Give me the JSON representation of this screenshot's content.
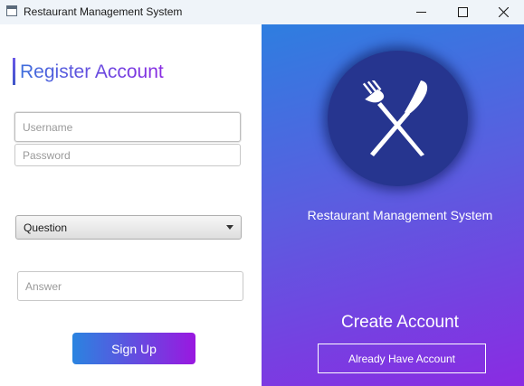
{
  "window": {
    "title": "Restaurant Management System",
    "controls": {
      "minimize_icon": "minimize-icon",
      "maximize_icon": "maximize-icon",
      "close_icon": "close-icon"
    }
  },
  "form": {
    "heading": "Register Account",
    "username_placeholder": "Username",
    "password_placeholder": "Password",
    "question_selected": "Question",
    "answer_placeholder": "Answer",
    "signup_label": "Sign Up"
  },
  "side_panel": {
    "logo_icon": "fork-knife-icon",
    "app_name": "Restaurant Management System",
    "create_title": "Create Account",
    "already_label": "Already Have Account"
  },
  "colors": {
    "gradient_start": "#2e7ee0",
    "gradient_end": "#8a2be2",
    "logo_circle": "#26358f"
  }
}
